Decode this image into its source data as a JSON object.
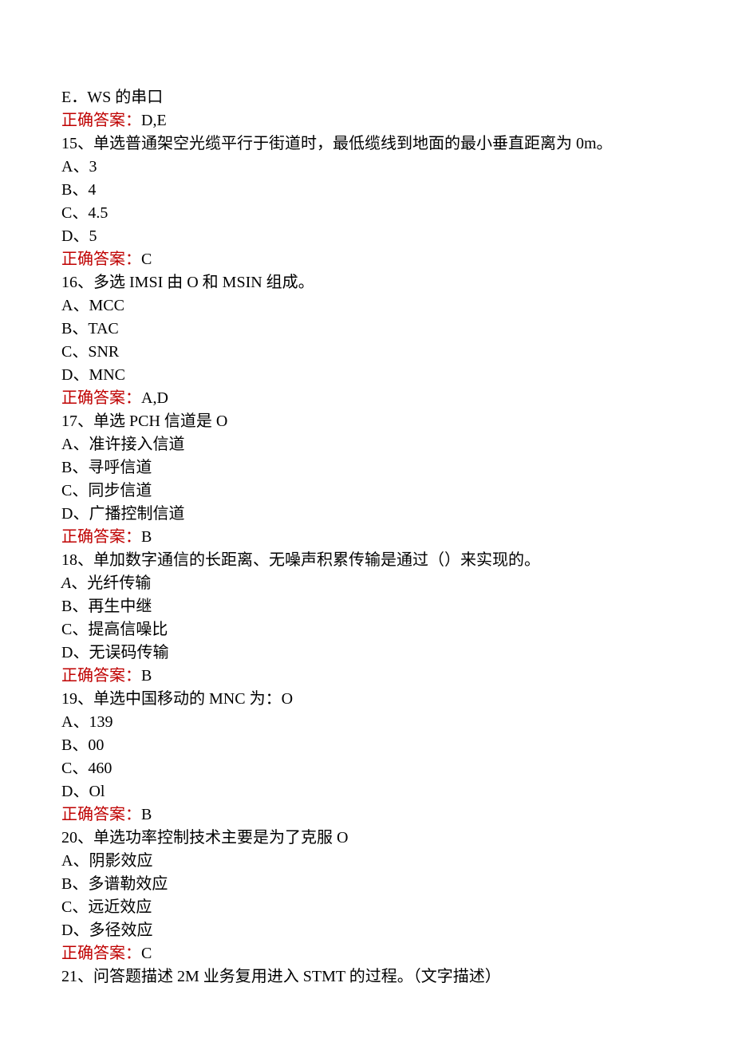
{
  "lines": {
    "l1": "E．WS 的串口",
    "l2a": "正确答案：",
    "l2b": "D,E",
    "l3": "15、单选普通架空光缆平行于街道时，最低缆线到地面的最小垂直距离为 0m。",
    "l4": "A、3",
    "l5": "B、4",
    "l6": "C、4.5",
    "l7": "D、5",
    "l8a": "正确答案：",
    "l8b": "C",
    "l9": "16、多选 IMSI 由 O 和 MSIN 组成。",
    "l10": "A、MCC",
    "l11": "B、TAC",
    "l12": "C、SNR",
    "l13": "D、MNC",
    "l14a": "正确答案：",
    "l14b": "A,D",
    "l15": "17、单选 PCH 信道是 O",
    "l16": "A、准许接入信道",
    "l17": "B、寻呼信道",
    "l18": "C、同步信道",
    "l19": "D、广播控制信道",
    "l20a": "正确答案：",
    "l20b": "B",
    "l21": "18、单加数字通信的长距离、无噪声积累传输是通过（）来实现的。",
    "l22a": "A",
    "l22b": "、光纤传输",
    "l23": "B、再生中继",
    "l24": "C、提高信噪比",
    "l25": "D、无误码传输",
    "l26a": "正确答案：",
    "l26b": "B",
    "l27": "19、单选中国移动的 MNC 为：O",
    "l28": "A、139",
    "l29": "B、00",
    "l30": "C、460",
    "l31": "D、Ol",
    "l32a": "正确答案：",
    "l32b": "B",
    "l33": "20、单选功率控制技术主要是为了克服 O",
    "l34": "A、阴影效应",
    "l35": "B、多谱勒效应",
    "l36": "C、远近效应",
    "l37": "D、多径效应",
    "l38a": "正确答案：",
    "l38b": "C",
    "l39": "21、问答题描述 2M 业务复用进入 STMT 的过程。（文字描述）"
  }
}
